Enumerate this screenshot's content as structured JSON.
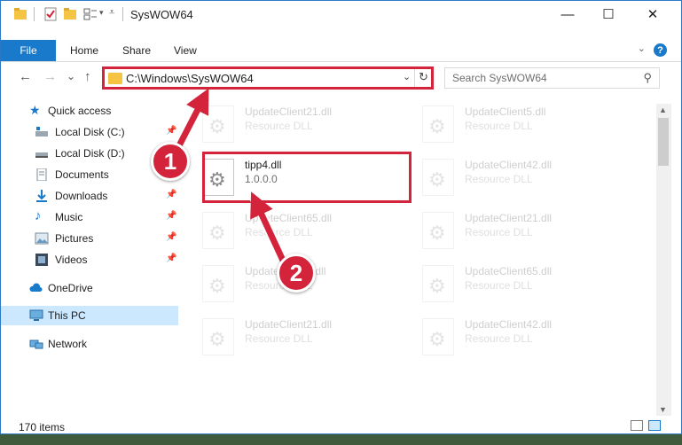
{
  "window": {
    "title": "SysWOW64",
    "minimize": "—",
    "maximize": "☐",
    "close": "✕"
  },
  "ribbon": {
    "file_label": "File",
    "tabs": [
      "Home",
      "Share",
      "View"
    ],
    "help": "?"
  },
  "navigation": {
    "back": "←",
    "forward": "→",
    "recent": "⌄",
    "up": "↑",
    "address": "C:\\Windows\\SysWOW64",
    "search_placeholder": "Search SysWOW64"
  },
  "sidebar": {
    "items": [
      {
        "label": "Quick access",
        "icon": "star-icon",
        "pinned": false
      },
      {
        "label": "Local Disk (C:)",
        "icon": "drive-icon",
        "pinned": true
      },
      {
        "label": "Local Disk (D:)",
        "icon": "drive-icon",
        "pinned": true
      },
      {
        "label": "Documents",
        "icon": "document-icon",
        "pinned": true
      },
      {
        "label": "Downloads",
        "icon": "download-icon",
        "pinned": true
      },
      {
        "label": "Music",
        "icon": "music-icon",
        "pinned": true
      },
      {
        "label": "Pictures",
        "icon": "pictures-icon",
        "pinned": true
      },
      {
        "label": "Videos",
        "icon": "video-icon",
        "pinned": true
      },
      {
        "label": "OneDrive",
        "icon": "cloud-icon",
        "pinned": false
      },
      {
        "label": "This PC",
        "icon": "computer-icon",
        "pinned": false
      },
      {
        "label": "Network",
        "icon": "network-icon",
        "pinned": false
      }
    ]
  },
  "files": [
    {
      "name": "UpdateClient21.dll",
      "desc": "Resource DLL"
    },
    {
      "name": "UpdateClient5.dll",
      "desc": "Resource DLL"
    },
    {
      "name": "tipp4.dll",
      "desc": "1.0.0.0"
    },
    {
      "name": "UpdateClient42.dll",
      "desc": "Resource DLL"
    },
    {
      "name": "UpdateClient65.dll",
      "desc": "Resource DLL"
    },
    {
      "name": "UpdateClient21.dll",
      "desc": "Resource DLL"
    },
    {
      "name": "UpdateClient5.dll",
      "desc": "Resource DLL"
    },
    {
      "name": "UpdateClient65.dll",
      "desc": "Resource DLL"
    },
    {
      "name": "UpdateClient21.dll",
      "desc": "Resource DLL"
    },
    {
      "name": "UpdateClient42.dll",
      "desc": "Resource DLL"
    }
  ],
  "status": {
    "item_count": "170 items"
  },
  "annotations": {
    "step1": "1",
    "step2": "2",
    "accent_color": "#d3243b"
  },
  "colors": {
    "file_tab": "#1979ca",
    "selected": "#cce8ff",
    "folder": "#f6c443"
  }
}
